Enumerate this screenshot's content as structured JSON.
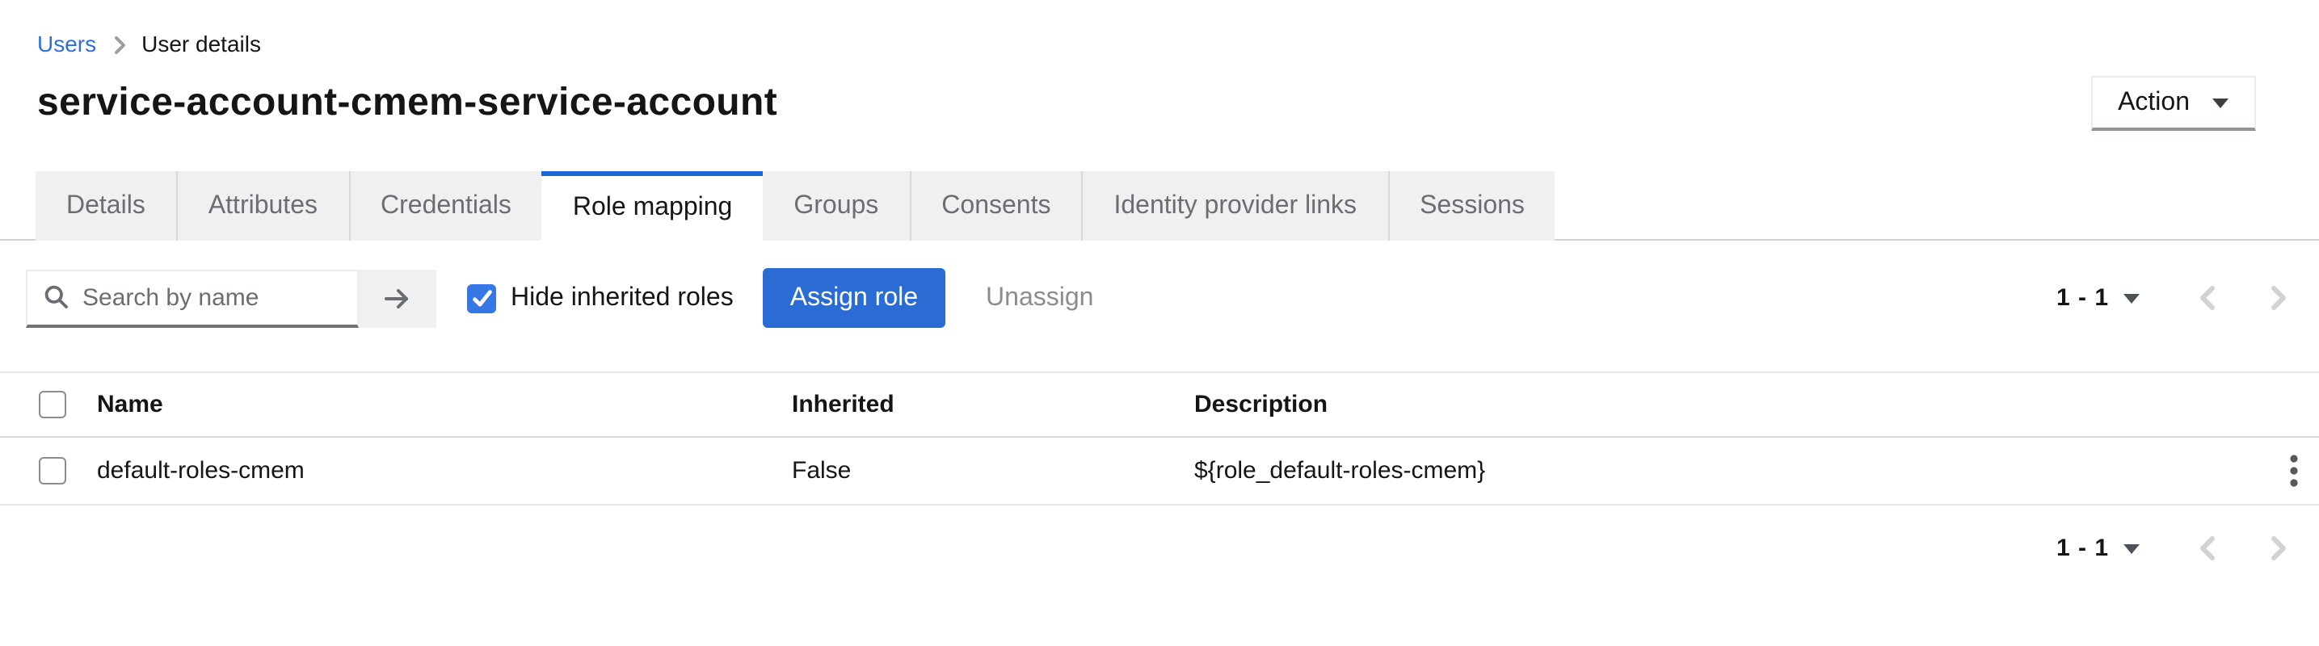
{
  "colors": {
    "link_blue": "#2e6fd9",
    "primary_blue": "#2b6bd4",
    "checkbox_blue": "#3577e4",
    "tab_indicator_blue": "#1f66d9",
    "text_dark": "#151515",
    "text_gray": "#6a6e73",
    "disabled_gray": "#8a8d90",
    "chevron_disabled": "#d2d2d2",
    "tab_bg": "#f0f0f0",
    "border_light": "#d2d2d2"
  },
  "breadcrumb": {
    "link": "Users",
    "current": "User details"
  },
  "header": {
    "title": "service-account-cmem-service-account",
    "action_label": "Action"
  },
  "tabs": [
    {
      "label": "Details"
    },
    {
      "label": "Attributes"
    },
    {
      "label": "Credentials"
    },
    {
      "label": "Role mapping"
    },
    {
      "label": "Groups"
    },
    {
      "label": "Consents"
    },
    {
      "label": "Identity provider links"
    },
    {
      "label": "Sessions"
    }
  ],
  "active_tab": "Role mapping",
  "toolbar": {
    "search_placeholder": "Search by name",
    "search_value": "",
    "hide_inherited_label": "Hide inherited roles",
    "hide_inherited_checked": true,
    "assign_label": "Assign role",
    "unassign_label": "Unassign"
  },
  "pagination": {
    "range": "1 - 1"
  },
  "table": {
    "columns": {
      "name": "Name",
      "inherited": "Inherited",
      "description": "Description"
    },
    "rows": [
      {
        "name": "default-roles-cmem",
        "inherited": "False",
        "description": "${role_default-roles-cmem}"
      }
    ]
  }
}
